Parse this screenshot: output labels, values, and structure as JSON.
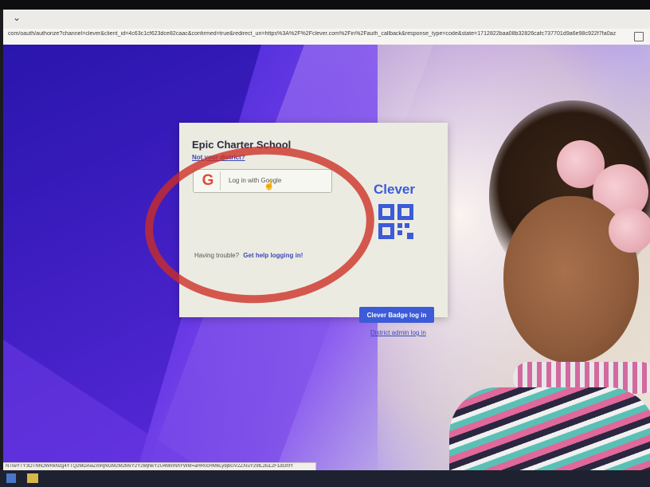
{
  "browser": {
    "url": "com/oauth/authorize?channel=clever&client_id=4c63c1cf623dce82caac&confirmed=true&redirect_uri=https%3A%2F%2Fclever.com%2Fin%2Fauth_callback&response_type=code&state=1712822baa08b32826cafc737701d9a6e98c922f7fa0az",
    "status_url": "NTIwYTY3OTNhOWRkNzg4YTQ2MDAwZmRjNGM2M2MxY2Y2MjNkY2U4MmNhYWM=aHR0cHM6Ly9jbGV2ZXIuY29tL2luL2F1dGhfY"
  },
  "login": {
    "school_name": "Epic Charter School",
    "not_district_link": "Not your district?",
    "google_button_label": "Log in with Google",
    "trouble_text": "Having trouble?",
    "help_link": "Get help logging in!",
    "clever_logo": "Clever",
    "badge_button": "Clever Badge log in",
    "district_admin_link": "District admin log in"
  },
  "colors": {
    "clever_blue": "#3b5bd8",
    "annotation_red": "#cd2d23",
    "card_bg": "#ecebe2"
  },
  "icons": {
    "google": "google-g-icon",
    "qr": "qr-code-icon",
    "cursor": "hand-cursor-icon"
  }
}
